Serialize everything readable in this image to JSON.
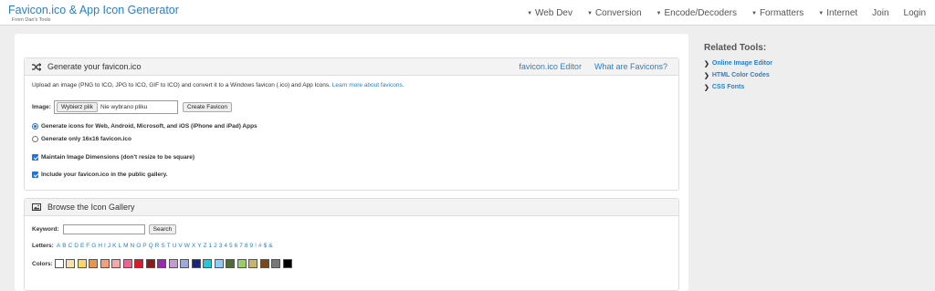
{
  "header": {
    "title": "Favicon.ico & App Icon Generator",
    "subtitle": "From Dan's Tools",
    "nav": [
      "Web Dev",
      "Conversion",
      "Encode/Decoders",
      "Formatters",
      "Internet"
    ],
    "login_links": [
      "Join",
      "Login"
    ]
  },
  "generate": {
    "heading": "Generate your favicon.ico",
    "links": [
      "favicon.ico Editor",
      "What are Favicons?"
    ],
    "intro": "Upload an image (PNG to ICO, JPG to ICO, GIF to ICO) and convert it to a Windows favicon (.ico) and App Icons.",
    "learn_more": "Learn more about favicons.",
    "image_label": "Image:",
    "file_button": "Wybierz plik",
    "file_status": "Nie wybrano pliku",
    "create_button": "Create Favicon",
    "option_all": "Generate icons for Web, Android, Microsoft, and iOS (iPhone and iPad) Apps",
    "option_16": "Generate only 16x16 favicon.ico",
    "maintain": "Maintain Image Dimensions (don't resize to be square)",
    "gallery_opt": "Include your favicon.ico in the public gallery.",
    "selected_option": "all",
    "maintain_checked": true,
    "gallery_checked": true
  },
  "browse": {
    "heading": "Browse the Icon Gallery",
    "keyword_label": "Keyword:",
    "keyword_value": "",
    "search_button": "Search",
    "letters_label": "Letters:",
    "letters": [
      "A",
      "B",
      "C",
      "D",
      "E",
      "F",
      "G",
      "H",
      "I",
      "J",
      "K",
      "L",
      "M",
      "N",
      "O",
      "P",
      "Q",
      "R",
      "S",
      "T",
      "U",
      "V",
      "W",
      "X",
      "Y",
      "Z",
      "1",
      "2",
      "3",
      "4",
      "5",
      "6",
      "7",
      "8",
      "9",
      "!",
      "#",
      "$",
      "&"
    ],
    "colors_label": "Colors:",
    "colors": [
      "#ffffff",
      "#f3e2a9",
      "#f5d76e",
      "#e8944a",
      "#f2a07b",
      "#f7a8a8",
      "#f06292",
      "#e0162b",
      "#8b1a1a",
      "#9c27b0",
      "#c39bd3",
      "#9fa8da",
      "#1a237e",
      "#26c6da",
      "#90caf9",
      "#4e6b3a",
      "#9ccc65",
      "#c8b56a",
      "#7b4a12",
      "#777777",
      "#000000"
    ]
  },
  "related": {
    "title": "Related Tools:",
    "items": [
      "Online Image Editor",
      "HTML Color Codes",
      "CSS Fonts"
    ]
  },
  "accent_color": "#2a7fc9"
}
